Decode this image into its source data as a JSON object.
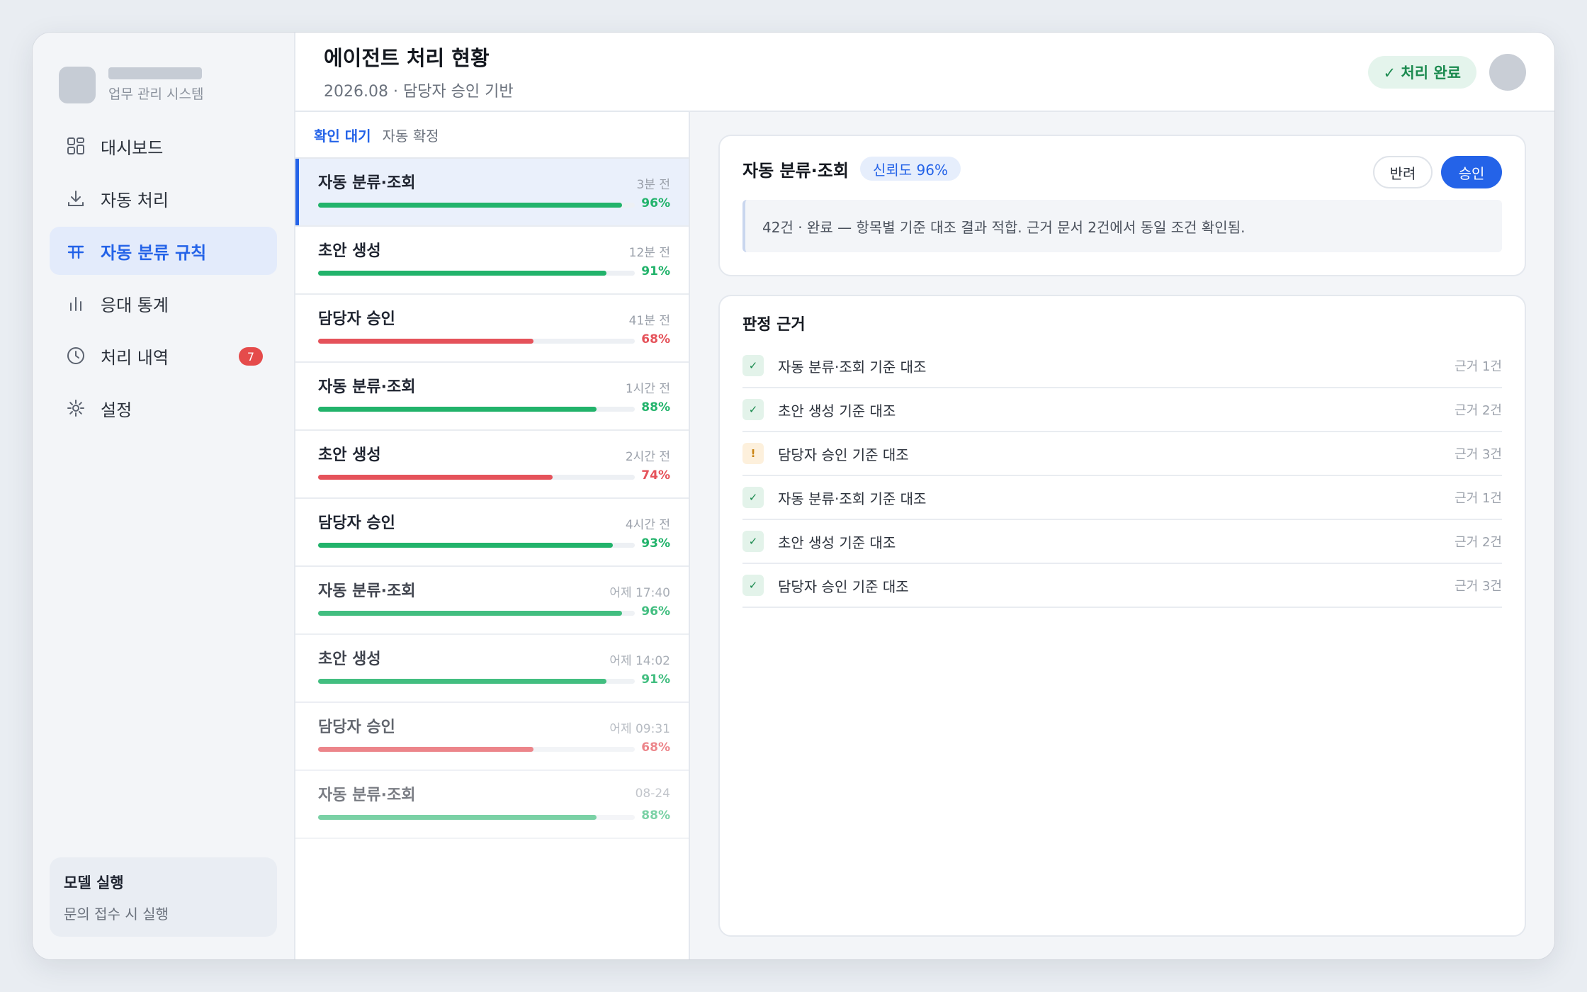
{
  "brand": {
    "subtitle": "업무 관리 시스템"
  },
  "sidebar": {
    "items": [
      {
        "label": "대시보드",
        "icon": "dashboard-icon",
        "active": false
      },
      {
        "label": "자동 처리",
        "icon": "download-icon",
        "active": false
      },
      {
        "label": "자동 분류 규칙",
        "icon": "table-icon",
        "active": true
      },
      {
        "label": "응대 통계",
        "icon": "bar-chart-icon",
        "active": false
      },
      {
        "label": "처리 내역",
        "icon": "clock-icon",
        "active": false,
        "badge": "7"
      },
      {
        "label": "설정",
        "icon": "gear-icon",
        "active": false
      }
    ],
    "model": {
      "title": "모델 실행",
      "subtitle": "문의 접수 시 실행"
    }
  },
  "header": {
    "title": "에이전트 처리 현황",
    "subtitle": "2026.08 · 담당자 승인 기반",
    "status": "✓ 처리 완료"
  },
  "list": {
    "tabs": [
      {
        "label": "확인 대기",
        "active": true
      },
      {
        "label": "자동 확정",
        "active": false
      }
    ],
    "rows": [
      {
        "title": "자동 분류·조회",
        "time": "3분 전",
        "progress": 96,
        "pct": "96%",
        "status": "good"
      },
      {
        "title": "초안 생성",
        "time": "12분 전",
        "progress": 91,
        "pct": "91%",
        "status": "good"
      },
      {
        "title": "담당자 승인",
        "time": "41분 전",
        "progress": 68,
        "pct": "68%",
        "status": "bad"
      },
      {
        "title": "자동 분류·조회",
        "time": "1시간 전",
        "progress": 88,
        "pct": "88%",
        "status": "good"
      },
      {
        "title": "초안 생성",
        "time": "2시간 전",
        "progress": 74,
        "pct": "74%",
        "status": "bad"
      },
      {
        "title": "담당자 승인",
        "time": "4시간 전",
        "progress": 93,
        "pct": "93%",
        "status": "good"
      },
      {
        "title": "자동 분류·조회",
        "time": "어제 17:40",
        "progress": 96,
        "pct": "96%",
        "status": "good"
      },
      {
        "title": "초안 생성",
        "time": "어제 14:02",
        "progress": 91,
        "pct": "91%",
        "status": "good"
      },
      {
        "title": "담당자 승인",
        "time": "어제 09:31",
        "progress": 68,
        "pct": "68%",
        "status": "bad"
      },
      {
        "title": "자동 분류·조회",
        "time": "08-24",
        "progress": 88,
        "pct": "88%",
        "status": "good"
      }
    ]
  },
  "detail": {
    "title": "자동 분류·조회",
    "confidence": "신뢰도 96%",
    "reject_label": "반려",
    "approve_label": "승인",
    "note": "42건 · 완료 — 항목별 기준 대조 결과 적합. 근거 문서 2건에서 동일 조건 확인됨.",
    "evidence_title": "판정 근거",
    "evidence": [
      {
        "label": "자동 분류·조회 기준 대조",
        "count": "근거 1건",
        "state": "ok",
        "mark": "✓"
      },
      {
        "label": "초안 생성 기준 대조",
        "count": "근거 2건",
        "state": "ok",
        "mark": "✓"
      },
      {
        "label": "담당자 승인 기준 대조",
        "count": "근거 3건",
        "state": "warn",
        "mark": "!"
      },
      {
        "label": "자동 분류·조회 기준 대조",
        "count": "근거 1건",
        "state": "ok",
        "mark": "✓"
      },
      {
        "label": "초안 생성 기준 대조",
        "count": "근거 2건",
        "state": "ok",
        "mark": "✓"
      },
      {
        "label": "담당자 승인 기준 대조",
        "count": "근거 3건",
        "state": "ok",
        "mark": "✓"
      }
    ]
  },
  "colors": {
    "accent": "#2463e8",
    "good": "#22b36b",
    "bad": "#e5525a"
  }
}
